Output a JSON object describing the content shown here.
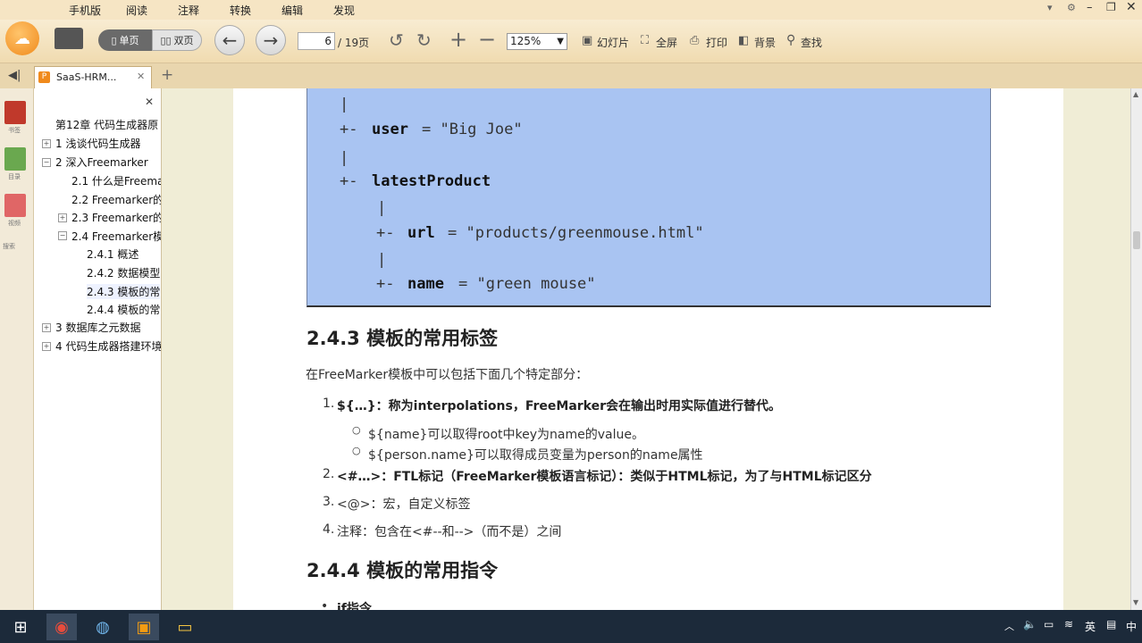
{
  "menu": [
    "手机版",
    "阅读",
    "注释",
    "转换",
    "编辑",
    "发现"
  ],
  "toolbar": {
    "single_page": "单页",
    "double_page": "双页",
    "page_current": "6",
    "page_total": "/ 19页",
    "zoom": "125%",
    "slideshow": "幻灯片",
    "fullscreen": "全屏",
    "print": "打印",
    "background": "背景",
    "find": "查找"
  },
  "tab": {
    "label": "SaaS-HRM..."
  },
  "sidestrip": [
    "书签",
    "目录",
    "视频",
    "搜索"
  ],
  "toc": [
    "第12章 代码生成器原",
    "1 浅谈代码生成器",
    "2 深入Freemarker",
    "2.1 什么是Freema",
    "2.2 Freemarker的",
    "2.3 Freemarker的",
    "2.4 Freemarker模",
    "2.4.1 概述",
    "2.4.2 数据模型",
    "2.4.3 模板的常",
    "2.4.4 模板的常",
    "3 数据库之元数据",
    "4 代码生成器搭建环境"
  ],
  "code": {
    "pipe": "|",
    "branch": "+-",
    "user_key": "user",
    "user_val": "= \"Big Joe\"",
    "latest_key": "latestProduct",
    "url_key": "url",
    "url_val": "= \"products/greenmouse.html\"",
    "name_key": "name",
    "name_val": "= \"green mouse\""
  },
  "doc": {
    "h_243": "2.4.3 模板的常用标签",
    "intro": "在FreeMarker模板中可以包括下面几个特定部分：",
    "item1_num": "1.",
    "item1": "${…}：称为interpolations，FreeMarker会在输出时用实际值进行替代。",
    "sub1": "${name}可以取得root中key为name的value。",
    "sub2": "${person.name}可以取得成员变量为person的name属性",
    "item2_num": "2.",
    "item2": "<#…>：FTL标记（FreeMarker模板语言标记）：类似于HTML标记，为了与HTML标记区分",
    "item3_num": "3.",
    "item3": "<@>：宏，自定义标签",
    "item4_num": "4.",
    "item4": "注释：包含在<#--和-->（而不是）之间",
    "h_244": "2.4.4 模板的常用指令",
    "bullet_if": "if指令"
  },
  "tray": {
    "ime": "英",
    "lang": "中"
  }
}
